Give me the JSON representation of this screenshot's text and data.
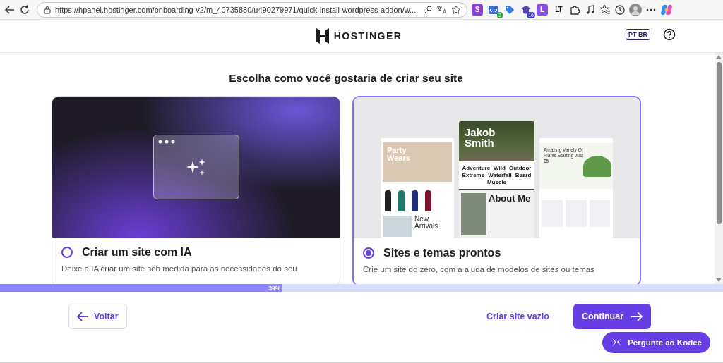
{
  "browser": {
    "url": "https://hpanel.hostinger.com/onboarding-v2/m_40735880/u490279971/quick-install-wordpress-addon/w...",
    "extensions": [
      {
        "kind": "s-letter",
        "label": "S"
      },
      {
        "kind": "code",
        "badge": "2"
      },
      {
        "kind": "tag"
      },
      {
        "kind": "cap",
        "badge": "16"
      },
      {
        "kind": "l-letter",
        "label": "L"
      },
      {
        "kind": "lt",
        "label": "LT"
      },
      {
        "kind": "puzzle"
      }
    ]
  },
  "header": {
    "logo": "HOSTINGER",
    "language": "PT BR"
  },
  "page": {
    "title": "Escolha como você gostaria de criar seu site",
    "cards": [
      {
        "kind": "ai",
        "title": "Criar um site com IA",
        "description": "Deixe a IA criar um site sob medida para as necessidades do seu",
        "selected": false
      },
      {
        "kind": "templates",
        "title": "Sites e temas prontos",
        "description": "Crie um site do zero, com a ajuda de modelos de sites ou temas",
        "selected": true,
        "previews": {
          "shop": [
            "Party Wears",
            "New Arrivals"
          ],
          "portfolio": {
            "name": "Jakob Smith",
            "tags": [
              "Adventure",
              "Wild",
              "Outdoor",
              "Extreme",
              "Waterfall",
              "Beard",
              "Muscle"
            ],
            "heading": "About Me"
          },
          "plants": "Amazing Variety Of Plants Starting Just $5"
        }
      }
    ]
  },
  "progress": {
    "level": 0.39,
    "label": "39%"
  },
  "footer": {
    "back": "Voltar",
    "empty_site": "Criar site vazio",
    "continue": "Continuar",
    "assistant": "Pergunte ao Kodee"
  }
}
